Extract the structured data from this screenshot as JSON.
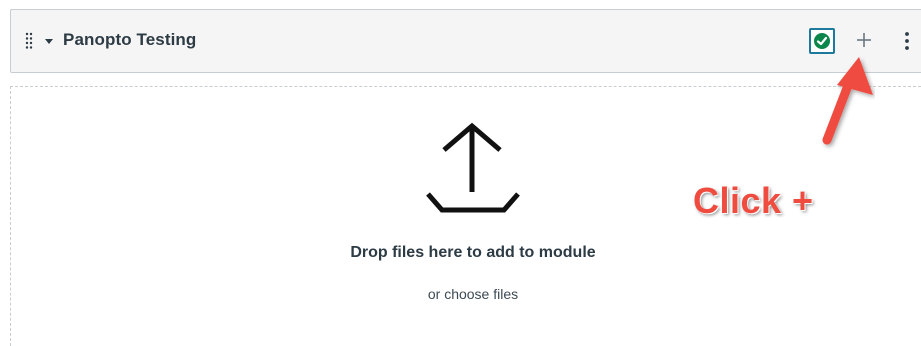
{
  "module": {
    "title": "Panopto Testing",
    "drag_icon": "drag-handle-icon",
    "caret_icon": "caret-down-icon",
    "publish_icon": "published-check-icon",
    "add_icon": "plus-icon",
    "options_icon": "kebab-menu-icon",
    "add_label": "+",
    "options_label": "⋮"
  },
  "dropzone": {
    "icon": "upload-icon",
    "title": "Drop files here to add to module",
    "subtitle": "or choose files"
  },
  "annotation": {
    "text": "Click +",
    "color": "#ef4b3f"
  },
  "colors": {
    "header_bg": "#f5f5f5",
    "publish_green": "#0b874b",
    "publish_border": "#1d7a9c",
    "text_dark": "#2d3b45"
  }
}
